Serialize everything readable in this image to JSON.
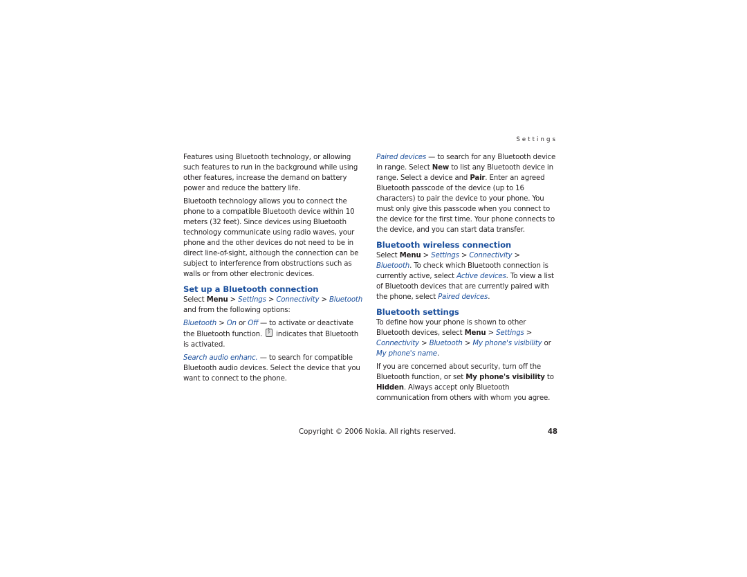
{
  "running_head": "Settings",
  "left_column": {
    "para1": "Features using Bluetooth technology, or allowing such features to run in the background while using other features, increase the demand on battery power and reduce the battery life.",
    "para2": "Bluetooth technology allows you to connect the phone to a compatible Bluetooth device within 10 meters (32 feet). Since devices using Bluetooth technology communicate using radio waves, your phone and the other devices do not need to be in direct line-of-sight, although the connection can be subject to interference from obstructions such as walls or from other electronic devices.",
    "heading_setup": "Set up a Bluetooth connection",
    "setup_select": "Select ",
    "menu": "Menu",
    "sep": " > ",
    "settings": "Settings",
    "connectivity": "Connectivity",
    "bluetooth": "Bluetooth",
    "setup_tail": " and from the following options:",
    "opt1_bluetooth": "Bluetooth",
    "opt1_on": "On",
    "opt1_or": " or ",
    "opt1_off": "Off",
    "opt1_text": " — to activate or deactivate the Bluetooth function.",
    "opt1_icon_semantic": "bluetooth-active-icon",
    "opt1_text2": "indicates that Bluetooth is activated.",
    "opt2_link": "Search audio enhanc.",
    "opt2_text": " — to search for compatible Bluetooth audio devices. Select the device that you want to connect to the phone."
  },
  "right_column": {
    "paired_link": "Paired devices",
    "paired_text1": " — to search for any Bluetooth device in range. Select ",
    "new": "New",
    "paired_text2": " to list any Bluetooth device in range. Select a device and ",
    "pair": "Pair",
    "paired_text3": ". Enter an agreed Bluetooth passcode of the device (up to 16 characters) to pair the device to your phone. You must only give this passcode when you connect to the device for the first time. Your phone connects to the device, and you can start data transfer.",
    "heading_wireless": "Bluetooth wireless connection",
    "wireless_select": "Select ",
    "wireless_text1": ". To check which Bluetooth connection is currently active, select ",
    "active_devices": "Active devices",
    "wireless_text2": ". To view a list of Bluetooth devices that are currently paired with the phone, select ",
    "paired_devices": "Paired devices",
    "period": ".",
    "heading_settings": "Bluetooth settings",
    "settings_text1": "To define how your phone is shown to other Bluetooth devices, select ",
    "visibility": "My phone's visibility",
    "or": " or ",
    "phone_name": "My phone's name",
    "security_text1": "If you are concerned about security, turn off the Bluetooth function, or set ",
    "security_bold": "My phone's visibility",
    "security_to": " to ",
    "hidden": "Hidden",
    "security_text2": ". Always accept only Bluetooth communication from others with whom you agree."
  },
  "footer": {
    "copyright": "Copyright © 2006 Nokia. All rights reserved.",
    "page_number": "48"
  },
  "colors": {
    "link": "#1b4f9c",
    "text": "#231f20"
  }
}
